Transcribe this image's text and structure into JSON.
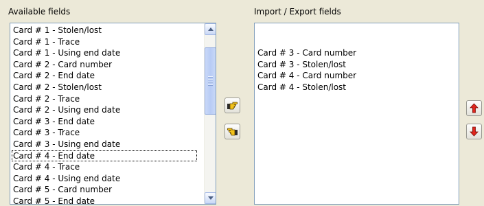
{
  "available": {
    "label": "Available fields",
    "items": [
      "Card # 1 - Stolen/lost",
      "Card # 1 - Trace",
      "Card # 1 - Using end date",
      "Card # 2 - Card number",
      "Card # 2 - End date",
      "Card # 2 - Stolen/lost",
      "Card # 2 - Trace",
      "Card # 2 - Using end date",
      "Card # 3 - End date",
      "Card # 3 - Trace",
      "Card # 3 - Using end date",
      "Card # 4 - End date",
      "Card # 4 - Trace",
      "Card # 4 - Using end date",
      "Card # 5 - Card number",
      "Card # 5 - End date"
    ],
    "focused_index": 11
  },
  "selected": {
    "label": "Import / Export fields",
    "items": [
      "",
      "",
      "Card # 3 - Card number",
      "Card # 3 - Stolen/lost",
      "Card # 4 - Card number",
      "Card # 4 - Stolen/lost"
    ]
  },
  "icons": {
    "add": "hand-pointing-right-icon",
    "remove": "hand-pointing-left-icon",
    "move_up": "red-arrow-up-icon",
    "move_down": "red-arrow-down-icon",
    "scroll_up": "scroll-up-arrow-icon",
    "scroll_down": "scroll-down-arrow-icon"
  },
  "colors": {
    "background": "#ece9d8",
    "list_border": "#7f9db9",
    "arrow_red": "#e0261d",
    "hand_yellow": "#f2c21a"
  }
}
